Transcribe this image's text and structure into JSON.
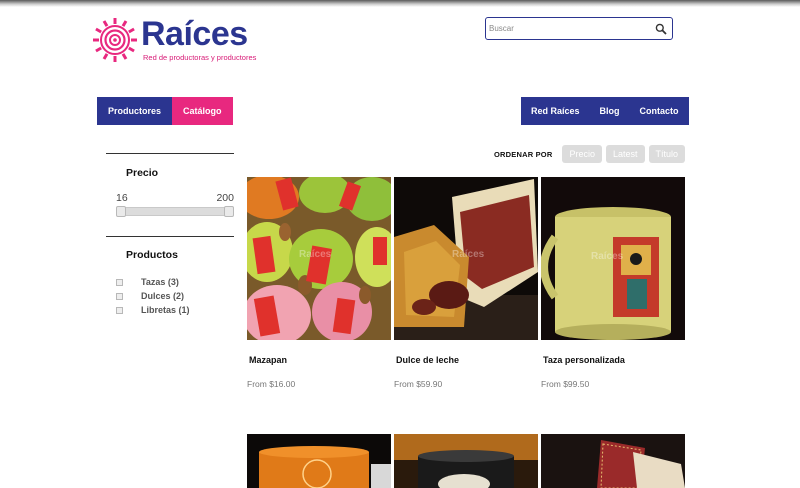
{
  "brand": {
    "name": "Raíces",
    "tagline": "Red de productoras y productores",
    "accent": "#e8287f",
    "primary": "#2b3590"
  },
  "search": {
    "placeholder": "Buscar",
    "icon": "search-icon"
  },
  "nav": {
    "left": [
      {
        "label": "Productores",
        "active": false
      },
      {
        "label": "Catálogo",
        "active": true
      }
    ],
    "right": [
      {
        "label": "Red Raíces"
      },
      {
        "label": "Blog"
      },
      {
        "label": "Contacto"
      }
    ]
  },
  "sidebar": {
    "price": {
      "title": "Precio",
      "min": "16",
      "max": "200",
      "range_fraction": [
        0,
        1
      ]
    },
    "products": {
      "title": "Productos",
      "categories": [
        {
          "label": "Tazas (3)"
        },
        {
          "label": "Dulces (2)"
        },
        {
          "label": "Libretas (1)"
        }
      ]
    }
  },
  "sort": {
    "label": "ORDENAR POR",
    "options": [
      "Precio",
      "Latest",
      "Título"
    ]
  },
  "products": [
    {
      "name": "Mazapan",
      "price": "From $16.00"
    },
    {
      "name": "Dulce de leche",
      "price": "From $59.90"
    },
    {
      "name": "Taza personalizada",
      "price": "From $99.50"
    }
  ],
  "watermark": "Raíces"
}
